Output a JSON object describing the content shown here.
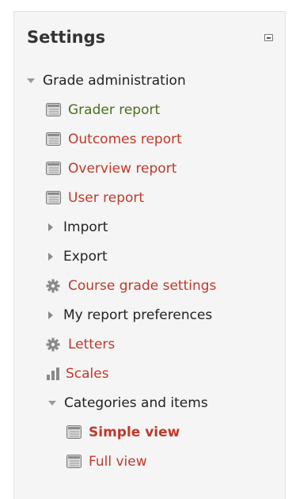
{
  "settings": {
    "title": "Settings"
  },
  "tree": {
    "grade_administration": "Grade administration",
    "grader_report": "Grader report",
    "outcomes_report": "Outcomes report",
    "overview_report": "Overview report",
    "user_report": "User report",
    "import": "Import",
    "export": "Export",
    "course_grade_settings": "Course grade settings",
    "my_report_preferences": "My report preferences",
    "letters": "Letters",
    "scales": "Scales",
    "categories_and_items": "Categories and items",
    "simple_view": "Simple view",
    "full_view": "Full view"
  },
  "icons": {
    "report": "report-icon",
    "gear": "gear-icon",
    "bar_chart": "bar-chart-icon",
    "expanded": "triangle-down-icon",
    "collapsed": "triangle-right-icon"
  },
  "colors": {
    "link": "#c0392b",
    "visited_link": "#4a6e1e",
    "text": "#222222",
    "block_background": "#f5f5f5"
  }
}
